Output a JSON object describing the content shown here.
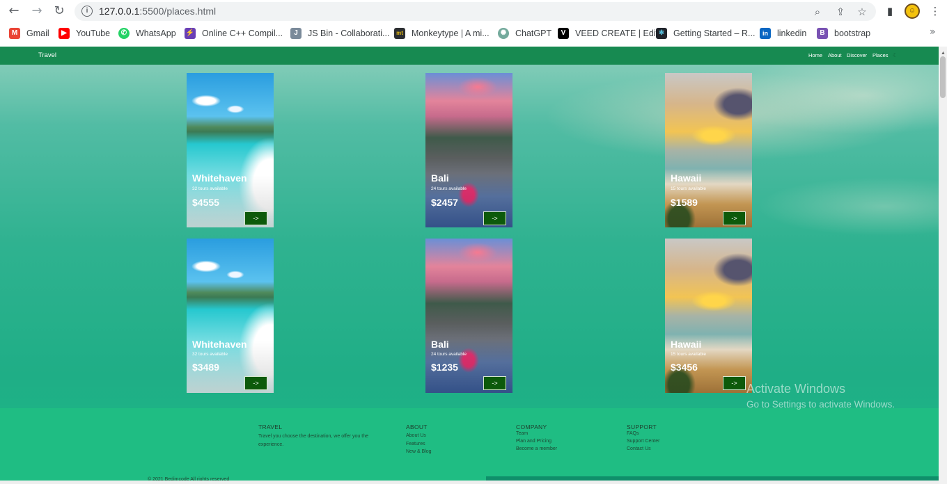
{
  "browser": {
    "url_host": "127.0.0.1",
    "url_rest": ":5500/places.html",
    "back_icon": "arrow-left-icon",
    "forward_icon": "arrow-right-icon",
    "reload_icon": "reload-icon"
  },
  "bookmarks": [
    {
      "label": "Gmail",
      "color": "#ea4335",
      "glyph": "M"
    },
    {
      "label": "YouTube",
      "color": "#ff0000",
      "glyph": "▶"
    },
    {
      "label": "WhatsApp",
      "color": "#25d366",
      "glyph": "✆"
    },
    {
      "label": "Online C++ Compil...",
      "color": "#6a3fb5",
      "glyph": "⚡"
    },
    {
      "label": "JS Bin - Collaborati...",
      "color": "#7a8a9a",
      "glyph": "J"
    },
    {
      "label": "Monkeytype | A mi...",
      "color": "#2c2e31",
      "glyph": "mt"
    },
    {
      "label": "ChatGPT",
      "color": "#74aa9c",
      "glyph": "✺"
    },
    {
      "label": "VEED CREATE | Edit",
      "color": "#000000",
      "glyph": "V"
    },
    {
      "label": "Getting Started – R...",
      "color": "#20232a",
      "glyph": "⚛"
    },
    {
      "label": "linkedin",
      "color": "#0a66c2",
      "glyph": "in"
    },
    {
      "label": "bootstrap",
      "color": "#7952b3",
      "glyph": "B"
    }
  ],
  "site": {
    "brand": "Travel",
    "menu": [
      "Home",
      "About",
      "Discover",
      "Places"
    ],
    "menu_extra": "☾"
  },
  "cards": [
    {
      "title": "Whitehaven",
      "tours": "32 tours available",
      "price": "$4555",
      "button": "->",
      "image": "beach"
    },
    {
      "title": "Bali",
      "tours": "24 tours available",
      "price": "$2457",
      "button": "->",
      "image": "bali"
    },
    {
      "title": "Hawaii",
      "tours": "15 tours available",
      "price": "$1589",
      "button": "->",
      "image": "hawaii"
    },
    {
      "title": "Whitehaven",
      "tours": "32 tours available",
      "price": "$3489",
      "button": "->",
      "image": "beach"
    },
    {
      "title": "Bali",
      "tours": "24 tours available",
      "price": "$1235",
      "button": "->",
      "image": "bali"
    },
    {
      "title": "Hawaii",
      "tours": "15 tours available",
      "price": "$3456",
      "button": "->",
      "image": "hawaii"
    }
  ],
  "footer": {
    "travel": {
      "heading": "TRAVEL",
      "text": "Travel you choose the destination, we offer you the experience."
    },
    "about": {
      "heading": "ABOUT",
      "links": [
        "About Us",
        "Features",
        "New & Blog"
      ]
    },
    "company": {
      "heading": "COMPANY",
      "links": [
        "Team",
        "Plan and Pricing",
        "Become a member"
      ]
    },
    "support": {
      "heading": "SUPPORT",
      "links": [
        "FAQs",
        "Support Center",
        "Contact Us"
      ]
    },
    "copyright": "© 2021 Bedimcode All rights reserved",
    "success": "success"
  },
  "watermark": {
    "line1": "Activate Windows",
    "line2": "Go to Settings to activate Windows."
  }
}
